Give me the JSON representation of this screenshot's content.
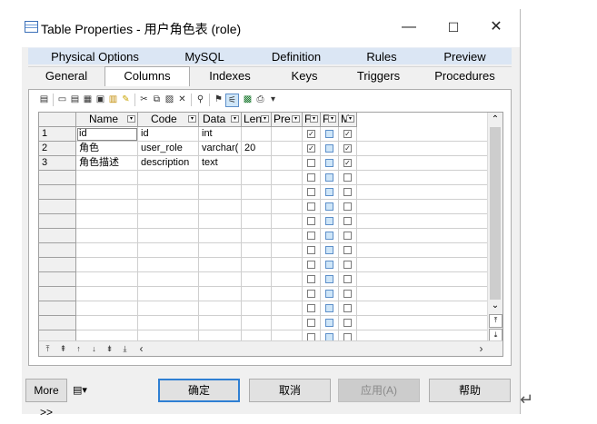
{
  "window": {
    "title": "Table Properties - 用户角色表 (role)",
    "minimize_glyph": "—",
    "maximize_glyph": "☐",
    "close_glyph": "✕"
  },
  "tabs_row1": [
    "Physical Options",
    "MySQL",
    "Definition",
    "Rules",
    "Preview"
  ],
  "tabs_row2": [
    "General",
    "Columns",
    "Indexes",
    "Keys",
    "Triggers",
    "Procedures"
  ],
  "active_tab": "Columns",
  "columns_grid": {
    "headers": [
      "Name",
      "Code",
      "Data",
      "Len",
      "Pre",
      "F",
      "F",
      "M"
    ],
    "rows": [
      {
        "num": "1",
        "name": "id",
        "code": "id",
        "data_type": "int",
        "length": "",
        "precision": "",
        "f1": true,
        "f2": false,
        "m": true
      },
      {
        "num": "2",
        "name": "角色",
        "code": "user_role",
        "data_type": "varchar(",
        "length": "20",
        "precision": "",
        "f1": true,
        "f2": false,
        "m": true
      },
      {
        "num": "3",
        "name": "角色描述",
        "code": "description",
        "data_type": "text",
        "length": "",
        "precision": "",
        "f1": false,
        "f2": false,
        "m": true
      }
    ],
    "empty_row_count": 12
  },
  "footer": {
    "more_label": "More >>",
    "ok_label": "确定",
    "cancel_label": "取消",
    "apply_label": "应用(A)",
    "help_label": "帮助"
  },
  "colors": {
    "accent": "#2f7fd3",
    "tab_inactive": "#dbe6f4",
    "checkbox_blue": "#cfe6f8"
  },
  "icons": {
    "window": "table-icon",
    "toolbar": [
      "properties-icon",
      "add-row-icon",
      "insert-row-icon",
      "add-rows-icon",
      "customize-icon",
      "copy-column-icon",
      "cut-icon",
      "copy-icon",
      "paste-icon",
      "delete-icon",
      "find-icon",
      "filter-icon",
      "filter-active-icon",
      "excel-icon",
      "print-icon",
      "dropdown-icon"
    ]
  }
}
